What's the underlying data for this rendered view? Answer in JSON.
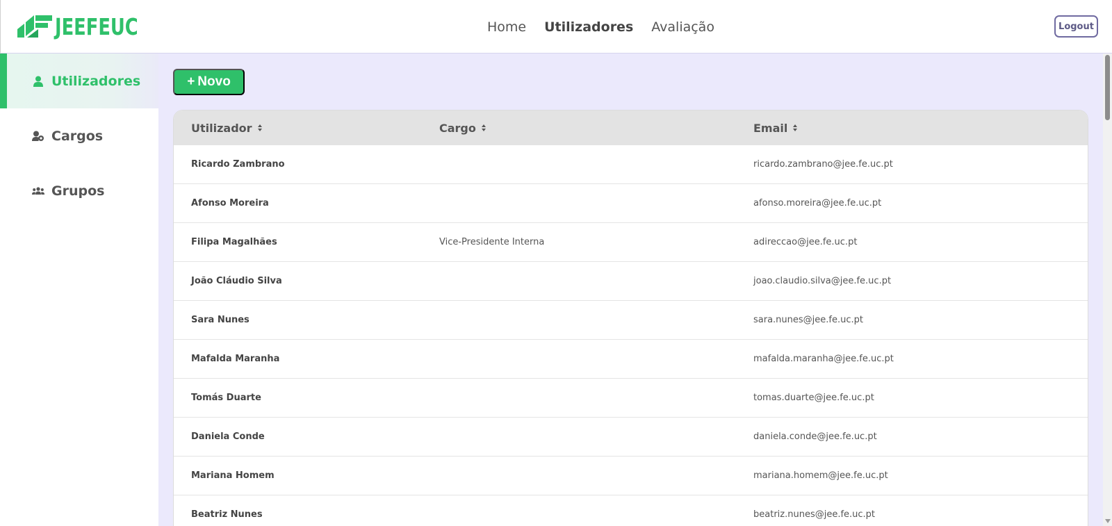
{
  "header": {
    "logo_text": "JEEFEUC",
    "nav": [
      {
        "label": "Home",
        "active": false
      },
      {
        "label": "Utilizadores",
        "active": true
      },
      {
        "label": "Avaliação",
        "active": false
      }
    ],
    "logout_label": "Logout"
  },
  "sidebar": {
    "items": [
      {
        "label": "Utilizadores",
        "icon": "user-icon",
        "active": true
      },
      {
        "label": "Cargos",
        "icon": "user-gear-icon",
        "active": false
      },
      {
        "label": "Grupos",
        "icon": "users-icon",
        "active": false
      }
    ]
  },
  "toolbar": {
    "new_label": "Novo",
    "new_icon": "+"
  },
  "table": {
    "columns": [
      "Utilizador",
      "Cargo",
      "Email"
    ],
    "rows": [
      {
        "name": "Ricardo Zambrano",
        "cargo": "",
        "email": "ricardo.zambrano@jee.fe.uc.pt"
      },
      {
        "name": "Afonso Moreira",
        "cargo": "",
        "email": "afonso.moreira@jee.fe.uc.pt"
      },
      {
        "name": "Filipa Magalhães",
        "cargo": "Vice-Presidente Interna",
        "email": "adireccao@jee.fe.uc.pt"
      },
      {
        "name": "João Cláudio Silva",
        "cargo": "",
        "email": "joao.claudio.silva@jee.fe.uc.pt"
      },
      {
        "name": "Sara Nunes",
        "cargo": "",
        "email": "sara.nunes@jee.fe.uc.pt"
      },
      {
        "name": "Mafalda Maranha",
        "cargo": "",
        "email": "mafalda.maranha@jee.fe.uc.pt"
      },
      {
        "name": "Tomás Duarte",
        "cargo": "",
        "email": "tomas.duarte@jee.fe.uc.pt"
      },
      {
        "name": "Daniela Conde",
        "cargo": "",
        "email": "daniela.conde@jee.fe.uc.pt"
      },
      {
        "name": "Mariana Homem",
        "cargo": "",
        "email": "mariana.homem@jee.fe.uc.pt"
      },
      {
        "name": "Beatriz Nunes",
        "cargo": "",
        "email": "beatriz.nunes@jee.fe.uc.pt"
      }
    ]
  },
  "colors": {
    "brand_green": "#2fc06a",
    "main_bg": "#ebe9fc",
    "header_row_bg": "#e3e3e3",
    "logout_border": "#6f6aa0"
  }
}
